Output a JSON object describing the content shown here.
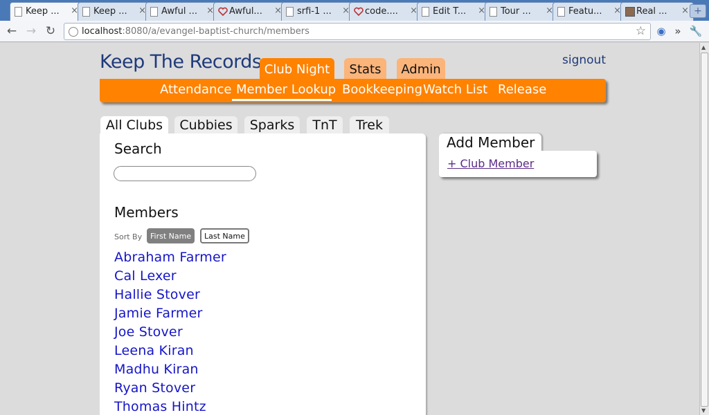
{
  "browser": {
    "tabs": [
      {
        "title": "Keep ...",
        "icon": "page-icon",
        "active": true
      },
      {
        "title": "Keep ...",
        "icon": "page-icon"
      },
      {
        "title": "Awful ...",
        "icon": "page-icon"
      },
      {
        "title": "Awful...",
        "icon": "heart-icon"
      },
      {
        "title": "srfi-1 ...",
        "icon": "page-icon"
      },
      {
        "title": "code....",
        "icon": "heart-icon"
      },
      {
        "title": "Edit T...",
        "icon": "page-icon"
      },
      {
        "title": "Tour ...",
        "icon": "page-icon"
      },
      {
        "title": "Featu...",
        "icon": "page-icon"
      },
      {
        "title": "Real ...",
        "icon": "person-icon"
      }
    ],
    "close_glyph": "×",
    "new_tab_glyph": "+",
    "url": {
      "host": "localhost",
      "path": ":8080/a/evangel-baptist-church/members"
    }
  },
  "header": {
    "logo": "Keep The Records",
    "signout": "signout",
    "main_tabs": [
      {
        "label": "Club Night",
        "active": true
      },
      {
        "label": "Stats"
      },
      {
        "label": "Admin"
      }
    ],
    "sub_nav": [
      {
        "label": "Attendance"
      },
      {
        "label": "Member Lookup",
        "active": true
      },
      {
        "label": "Bookkeeping"
      },
      {
        "label": "Watch List"
      },
      {
        "label": "Release"
      }
    ]
  },
  "clubs": {
    "tabs": [
      {
        "label": "All Clubs",
        "active": true
      },
      {
        "label": "Cubbies"
      },
      {
        "label": "Sparks"
      },
      {
        "label": "TnT"
      },
      {
        "label": "Trek"
      }
    ]
  },
  "main": {
    "search_heading": "Search",
    "search_value": "",
    "members_heading": "Members",
    "sort_by_label": "Sort By",
    "sort_first": "First Name",
    "sort_last": "Last Name",
    "sort_selected": "First Name",
    "members": [
      "Abraham Farmer",
      "Cal Lexer",
      "Hallie Stover",
      "Jamie Farmer",
      "Joe Stover",
      "Leena Kiran",
      "Madhu Kiran",
      "Ryan Stover",
      "Thomas Hintz"
    ]
  },
  "add_member": {
    "heading": "Add Member",
    "link": "+ Club Member"
  },
  "colors": {
    "accent": "#ff8200",
    "accent_light": "#fbb47a",
    "link": "#1515c7",
    "title": "#1e3a7a"
  }
}
